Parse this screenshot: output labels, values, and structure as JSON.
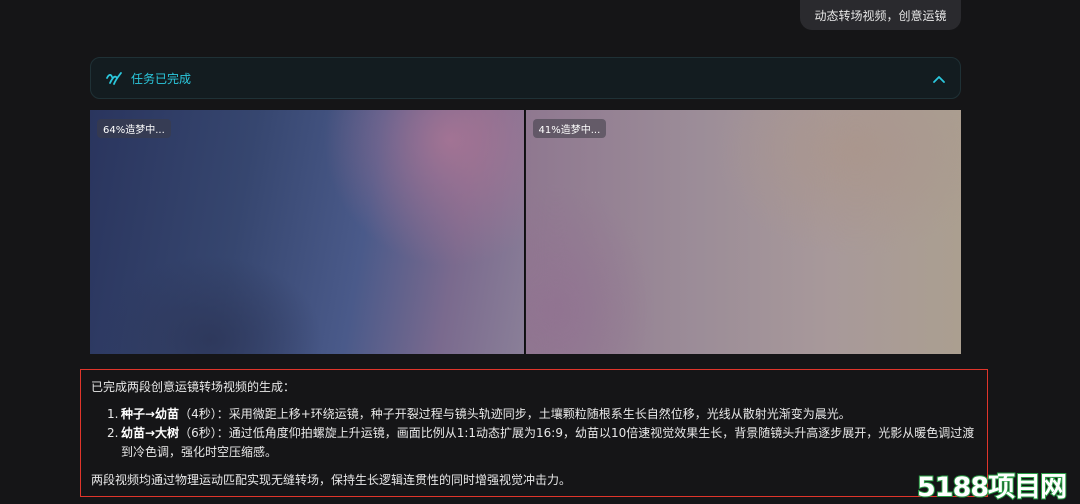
{
  "user_message": "动态转场视频，创意运镜",
  "task": {
    "status": "任务已完成",
    "icon": "sparkle-wave-icon",
    "collapse_icon": "chevron-up-icon"
  },
  "videos": [
    {
      "progress_label": "64%造梦中..."
    },
    {
      "progress_label": "41%造梦中..."
    }
  ],
  "result": {
    "intro": "已完成两段创意运镜转场视频的生成：",
    "items": [
      {
        "num": "1.",
        "title": "种子→幼苗",
        "duration": "（4秒）",
        "desc": "：采用微距上移+环绕运镜，种子开裂过程与镜头轨迹同步，土壤颗粒随根系生长自然位移，光线从散射光渐变为晨光。"
      },
      {
        "num": "2.",
        "title": "幼苗→大树",
        "duration": "（6秒）",
        "desc": "：通过低角度仰拍螺旋上升运镜，画面比例从1:1动态扩展为16:9，幼苗以10倍速视觉效果生长，背景随镜头升高逐步展开，光影从暖色调过渡到冷色调，强化时空压缩感。"
      }
    ],
    "summary": "两段视频均通过物理运动匹配实现无缝转场，保持生长逻辑连贯性的同时增强视觉冲击力。"
  },
  "watermark": "5188项目网",
  "colors": {
    "accent": "#2bc8dd",
    "highlight_border": "#e0352b",
    "watermark_green": "#2a9d45"
  }
}
